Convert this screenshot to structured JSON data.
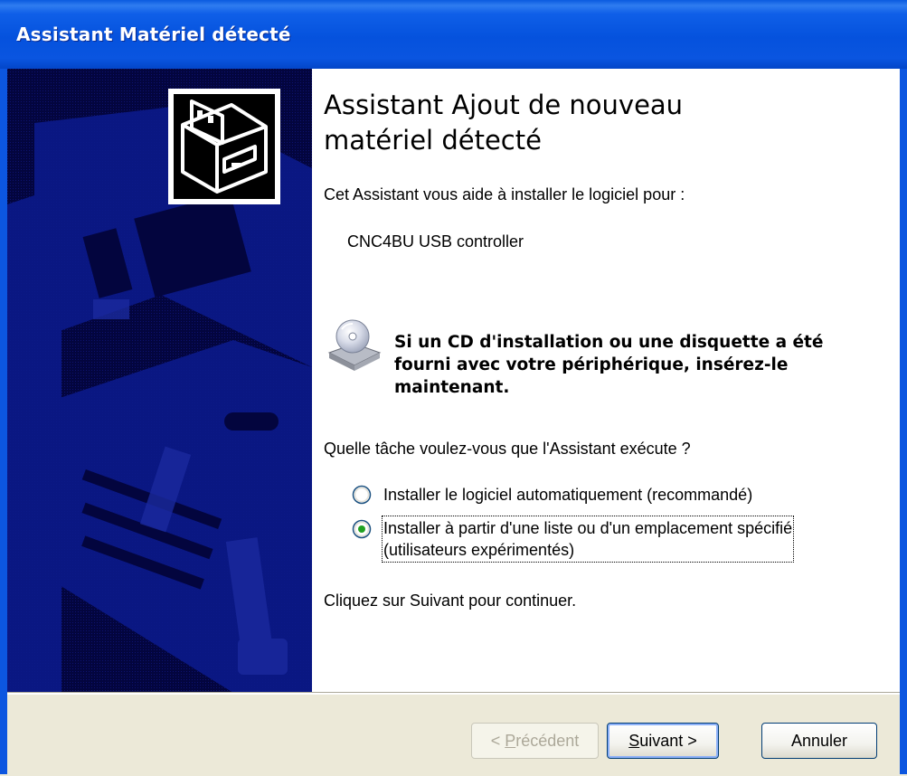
{
  "window": {
    "title": "Assistant Matériel détecté"
  },
  "wizard": {
    "heading_line1": "Assistant Ajout de nouveau",
    "heading_line2": "matériel détecté",
    "intro": "Cet Assistant vous aide à installer le logiciel pour :",
    "device_name": "CNC4BU USB controller",
    "cd_prompt_line1": "Si un CD d'installation ou une disquette a été",
    "cd_prompt_line2": "fourni avec votre périphérique, insérez-le",
    "cd_prompt_line3": "maintenant.",
    "question": "Quelle tâche voulez-vous que l'Assistant exécute ?",
    "options": [
      {
        "label": "Installer le logiciel automatiquement (recommandé)",
        "selected": false
      },
      {
        "label_line1": "Installer à partir d'une liste ou d'un emplacement spécifié",
        "label_line2": "(utilisateurs expérimentés)",
        "selected": true
      }
    ],
    "continue_hint": "Cliquez sur Suivant pour continuer."
  },
  "buttons": {
    "back_prefix": "< ",
    "back_mnemonic": "P",
    "back_rest": "récédent",
    "next_mnemonic": "S",
    "next_rest": "uivant >",
    "cancel": "Annuler"
  },
  "icons": {
    "hardware": "hardware-card-icon",
    "cd": "cd-drive-icon",
    "radio_off": "radio-unchecked-icon",
    "radio_on": "radio-checked-icon"
  },
  "colors": {
    "titlebar": "#0a55e0",
    "sidepanel": "#03053e",
    "content_bg": "#ffffff",
    "button_face": "#ece9d8",
    "radio_checked": "#21a121"
  }
}
